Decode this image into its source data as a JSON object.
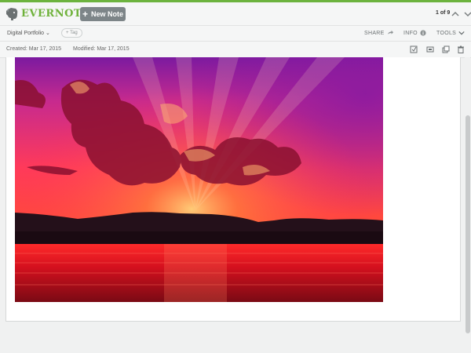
{
  "app": {
    "brand": "EVERNOTE",
    "brand_color": "#6fb23b",
    "accent_bar_color": "#6cb33e"
  },
  "topbar": {
    "new_note_label": "New Note",
    "new_note_icon": "plus-icon",
    "pager_text": "1 of 9",
    "nav_up_icon": "chevron-up-icon",
    "nav_down_icon": "chevron-down-icon"
  },
  "notebar": {
    "notebook": "Digital Portfolio",
    "tag_placeholder": "+ Tag",
    "share_label": "SHARE",
    "info_label": "INFO",
    "tools_label": "TOOLS"
  },
  "metabar": {
    "created": "Created: Mar 17, 2015",
    "modified": "Modified: Mar 17, 2015",
    "icons": [
      "reminder-icon",
      "present-icon",
      "copy-icon",
      "trash-icon"
    ]
  },
  "note": {
    "image_icon": "sunset-photo"
  }
}
